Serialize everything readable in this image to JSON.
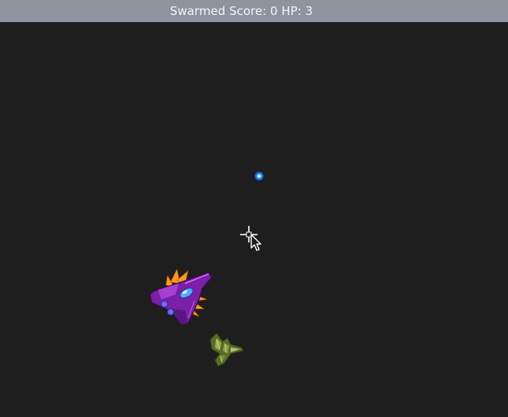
{
  "window": {
    "title": "Swarmed Score: 0 HP: 3"
  },
  "game": {
    "background_color": "#1e1e1e",
    "titlebar_color": "#8c959e",
    "sprites": {
      "bullet": "blue-energy-bullet",
      "cursor": "crosshair-arrow-cursor",
      "player": "purple-fighter-jet",
      "enemy": "green-alien-ship"
    }
  }
}
